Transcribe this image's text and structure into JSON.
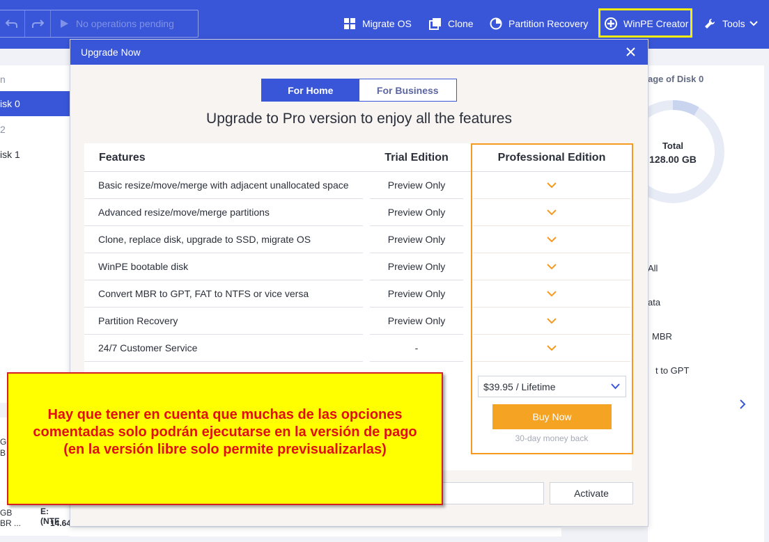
{
  "toolbar": {
    "pending_label": "No operations pending",
    "migrate_os": "Migrate OS",
    "clone": "Clone",
    "partition_recovery": "Partition Recovery",
    "winpe_creator": "WinPE Creator",
    "tools": "Tools"
  },
  "left_panel": {
    "items": [
      "n",
      "isk 0",
      "2",
      "isk 1"
    ]
  },
  "right_panel": {
    "title": "age of Disk 0",
    "total_label": "Total",
    "total_value": "128.00 GB",
    "links": [
      "All",
      "ata",
      "MBR",
      "t to GPT"
    ]
  },
  "background_bits": {
    "bottom_left_1": "GB",
    "bottom_left_2": "BR ...",
    "partition_name": "E: (NTF",
    "partition_size": "14.64",
    "side_1": "G",
    "side_2": "B"
  },
  "modal": {
    "title": "Upgrade Now",
    "tabs": [
      "For Home",
      "For Business"
    ],
    "headline": "Upgrade to Pro version to enjoy all the features",
    "columns": {
      "features": "Features",
      "trial": "Trial Edition",
      "pro": "Professional Edition"
    },
    "rows": [
      {
        "feature": "Basic resize/move/merge with adjacent unallocated space",
        "trial": "Preview Only"
      },
      {
        "feature": "Advanced resize/move/merge partitions",
        "trial": "Preview Only"
      },
      {
        "feature": "Clone, replace disk, upgrade to SSD, migrate OS",
        "trial": "Preview Only"
      },
      {
        "feature": "WinPE bootable disk",
        "trial": "Preview Only"
      },
      {
        "feature": "Convert MBR to GPT, FAT to NTFS or vice versa",
        "trial": "Preview Only"
      },
      {
        "feature": "Partition Recovery",
        "trial": "Preview Only"
      },
      {
        "feature": "24/7 Customer Service",
        "trial": "-"
      }
    ],
    "price_option": "$39.95 / Lifetime",
    "buy_label": "Buy Now",
    "money_back": "30-day money back",
    "activate_label": "Activate"
  },
  "note": {
    "text": "Hay que tener en cuenta que muchas de las opciones\ncomentadas solo podrán ejecutarse en la versión de pago\n(en la versión libre solo permite previsualizarlas)"
  },
  "colors": {
    "brand_blue": "#3a56d8",
    "pro_orange": "#f59a1f",
    "buy_orange": "#f5a322",
    "note_yellow": "#ffff00",
    "note_red": "#e01010",
    "highlight_yellow": "#f5ee0a"
  }
}
